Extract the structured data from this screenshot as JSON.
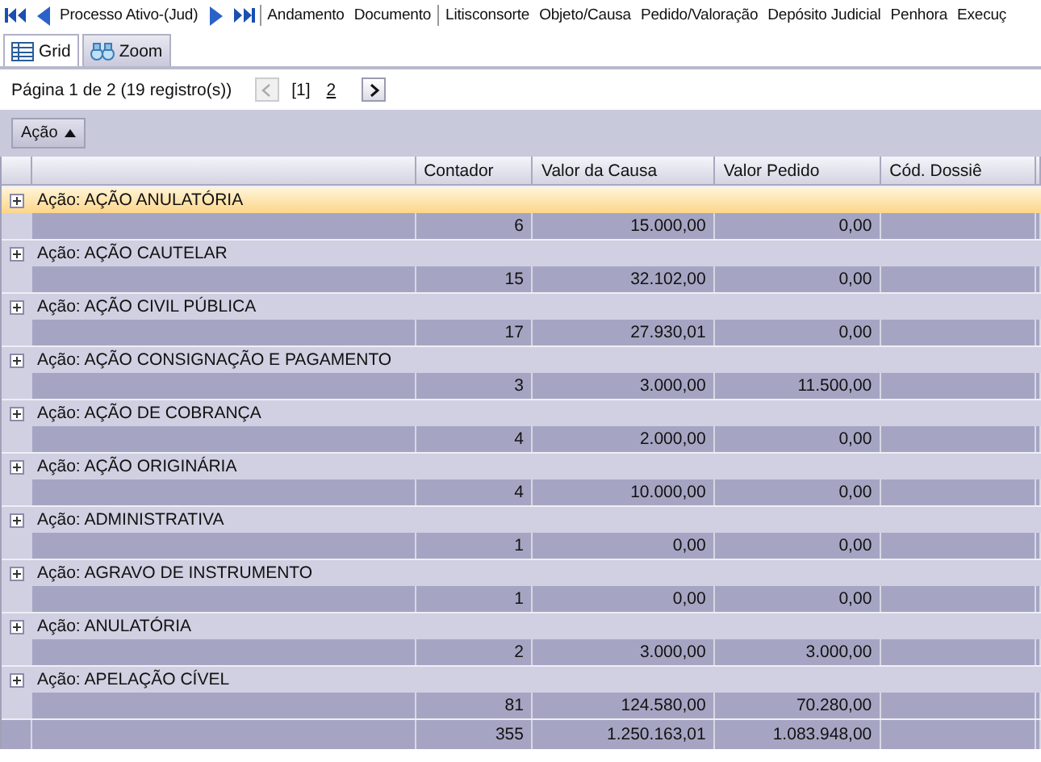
{
  "toolbar": {
    "prev_label": "Processo Ativo-(Jud)",
    "links": [
      "Andamento",
      "Documento",
      "Litisconsorte",
      "Objeto/Causa",
      "Pedido/Valoração",
      "Depósito Judicial",
      "Penhora",
      "Execuç"
    ]
  },
  "view_tabs": [
    {
      "label": "Grid",
      "selected": true
    },
    {
      "label": "Zoom",
      "selected": false
    }
  ],
  "pager": {
    "summary": "Página 1 de 2 (19 registro(s))",
    "pages": [
      {
        "label": "[1]",
        "selected": true
      },
      {
        "label": "2",
        "selected": false
      }
    ]
  },
  "group_by": {
    "label": "Ação",
    "sort_ascending": true
  },
  "table": {
    "columns": [
      "Contador",
      "Valor da Causa",
      "Valor Pedido",
      "Cód. Dossiê"
    ],
    "groups": [
      {
        "label": "Ação: AÇÃO ANULATÓRIA",
        "selected": true,
        "values": [
          "6",
          "15.000,00",
          "0,00"
        ]
      },
      {
        "label": "Ação: AÇÃO CAUTELAR",
        "selected": false,
        "values": [
          "15",
          "32.102,00",
          "0,00"
        ]
      },
      {
        "label": "Ação: AÇÃO CIVIL PÚBLICA",
        "selected": false,
        "values": [
          "17",
          "27.930,01",
          "0,00"
        ]
      },
      {
        "label": "Ação: AÇÃO CONSIGNAÇÃO E PAGAMENTO",
        "selected": false,
        "values": [
          "3",
          "3.000,00",
          "11.500,00"
        ]
      },
      {
        "label": "Ação: AÇÃO DE COBRANÇA",
        "selected": false,
        "values": [
          "4",
          "2.000,00",
          "0,00"
        ]
      },
      {
        "label": "Ação: AÇÃO ORIGINÁRIA",
        "selected": false,
        "values": [
          "4",
          "10.000,00",
          "0,00"
        ]
      },
      {
        "label": "Ação: ADMINISTRATIVA",
        "selected": false,
        "values": [
          "1",
          "0,00",
          "0,00"
        ]
      },
      {
        "label": "Ação: AGRAVO DE INSTRUMENTO",
        "selected": false,
        "values": [
          "1",
          "0,00",
          "0,00"
        ]
      },
      {
        "label": "Ação: ANULATÓRIA",
        "selected": false,
        "values": [
          "2",
          "3.000,00",
          "3.000,00"
        ]
      },
      {
        "label": "Ação: APELAÇÃO CÍVEL",
        "selected": false,
        "values": [
          "81",
          "124.580,00",
          "70.280,00"
        ]
      }
    ],
    "totals": [
      "355",
      "1.250.163,01",
      "1.083.948,00"
    ]
  }
}
